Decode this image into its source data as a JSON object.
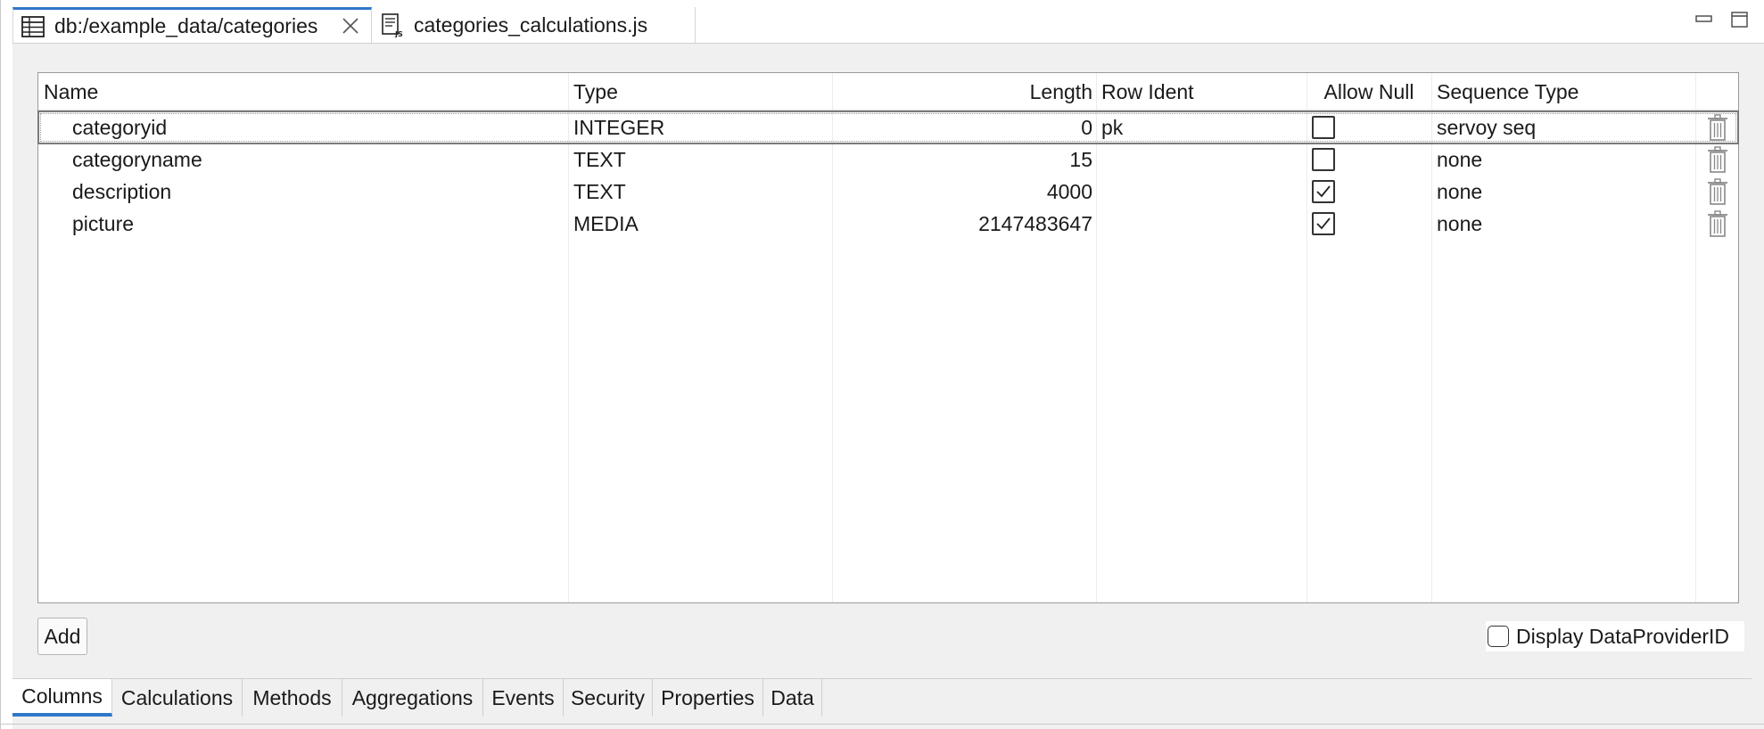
{
  "editor_tabs": [
    {
      "label": "db:/example_data/categories",
      "icon": "table-icon",
      "active": true
    },
    {
      "label": "categories_calculations.js",
      "icon": "js-file-icon",
      "active": false
    }
  ],
  "table": {
    "headers": {
      "name": "Name",
      "type": "Type",
      "length": "Length",
      "row_ident": "Row Ident",
      "allow_null": "Allow Null",
      "sequence_type": "Sequence Type"
    },
    "rows": [
      {
        "name": "categoryid",
        "type": "INTEGER",
        "length": "0",
        "row_ident": "pk",
        "allow_null": false,
        "sequence_type": "servoy seq",
        "selected": true
      },
      {
        "name": "categoryname",
        "type": "TEXT",
        "length": "15",
        "row_ident": "",
        "allow_null": false,
        "sequence_type": "none",
        "selected": false
      },
      {
        "name": "description",
        "type": "TEXT",
        "length": "4000",
        "row_ident": "",
        "allow_null": true,
        "sequence_type": "none",
        "selected": false
      },
      {
        "name": "picture",
        "type": "MEDIA",
        "length": "2147483647",
        "row_ident": "",
        "allow_null": true,
        "sequence_type": "none",
        "selected": false
      }
    ]
  },
  "controls": {
    "add_label": "Add",
    "display_dataprovider_label": "Display DataProviderID",
    "display_dataprovider_checked": false
  },
  "bottom_tabs": [
    "Columns",
    "Calculations",
    "Methods",
    "Aggregations",
    "Events",
    "Security",
    "Properties",
    "Data"
  ],
  "active_bottom_tab": "Columns",
  "colors": {
    "accent": "#2f78c9",
    "panel": "#f0f0f0"
  }
}
